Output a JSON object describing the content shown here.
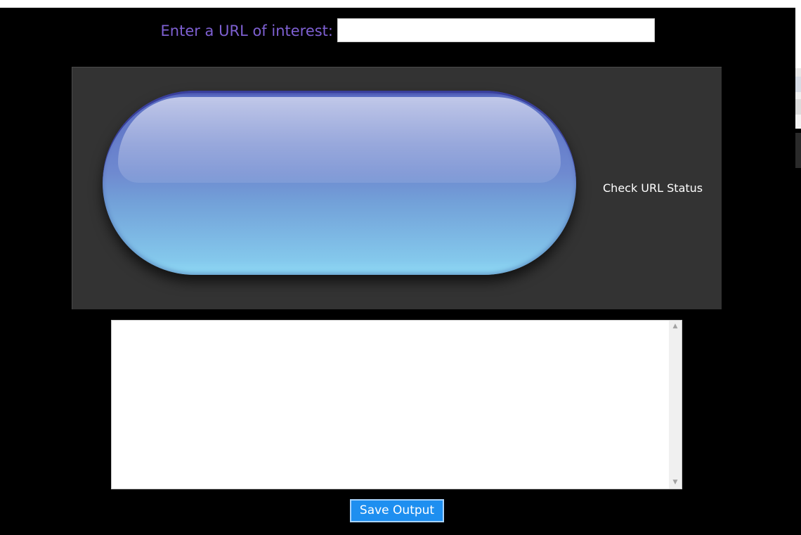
{
  "url_row": {
    "label": "Enter a URL of interest:",
    "input_value": "",
    "input_placeholder": ""
  },
  "status_panel": {
    "check_label": "Check URL Status"
  },
  "output": {
    "text": ""
  },
  "actions": {
    "save_label": "Save Output"
  },
  "colors": {
    "background": "#000000",
    "label_accent": "#7e60d2",
    "panel": "#333333",
    "button_top": "#3c42a0",
    "button_bottom": "#8fdaf5",
    "save_button": "#1e8ff0"
  },
  "icons": {
    "scroll_up": "chevron-up-icon",
    "scroll_down": "chevron-down-icon"
  }
}
